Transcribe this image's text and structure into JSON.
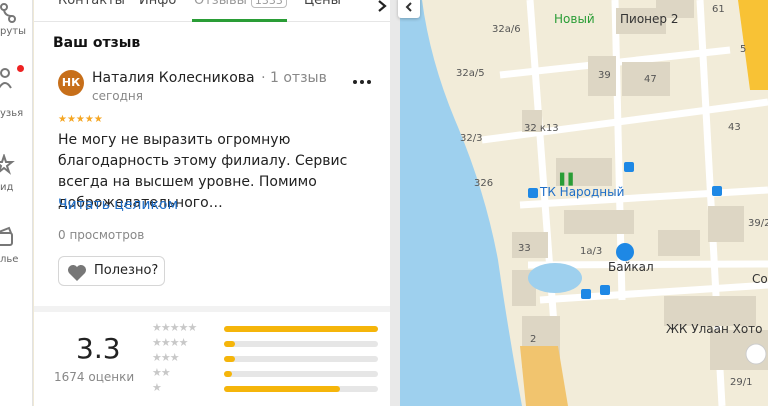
{
  "rail": {
    "items": [
      {
        "label": "руты",
        "icon": "route-icon"
      },
      {
        "label": "узья",
        "icon": "friends-icon"
      },
      {
        "label": "ид",
        "icon": "guide-icon"
      },
      {
        "label": "лье",
        "icon": "wallet-icon"
      }
    ]
  },
  "tabs": [
    {
      "label": "Контакты",
      "icon": ""
    },
    {
      "label": "Инфо"
    },
    {
      "label": "Отзывы",
      "count": "1333"
    },
    {
      "label": "Цены"
    }
  ],
  "review": {
    "heading": "Ваш отзыв",
    "avatar_initials": "НК",
    "author_name": "Наталия Колесникова",
    "author_reviews": "· 1 отзыв",
    "date": "сегодня",
    "stars": "★★★★★",
    "text": "Не могу не выразить огромную благодарность этому филиалу. Сервис всегда на высшем уровне. Помимо доброжелательного…",
    "read_more": "Читать целиком",
    "views": "0 просмотров",
    "helpful": "Полезно?"
  },
  "rating": {
    "value": "3.3",
    "count": "1674 оценки",
    "distribution": [
      {
        "stars": 5,
        "fraction": 1.0
      },
      {
        "stars": 4,
        "fraction": 0.07
      },
      {
        "stars": 3,
        "fraction": 0.07
      },
      {
        "stars": 2,
        "fraction": 0.05
      },
      {
        "stars": 1,
        "fraction": 0.75
      }
    ]
  },
  "map": {
    "labels": [
      "32а/6",
      "32а/5",
      "32/3",
      "32 к13",
      "326",
      "33",
      "1а/3",
      "39",
      "47",
      "61",
      "43",
      "39/2",
      "2",
      "29/1",
      "5"
    ],
    "places": {
      "novy": "Новый",
      "pioneer": "Пионер 2",
      "tk": "ТК Народный",
      "baikal": "Байкал",
      "so": "Со",
      "zhk": "ЖК Улаан Хото"
    },
    "colors": {
      "water": "#9ed0ee",
      "land": "#f2ecd9",
      "road": "#ffffff",
      "building": "#ddd6c4",
      "highway": "#f8c235",
      "green": "#2a9d36",
      "transit": "#1e88e5"
    }
  }
}
